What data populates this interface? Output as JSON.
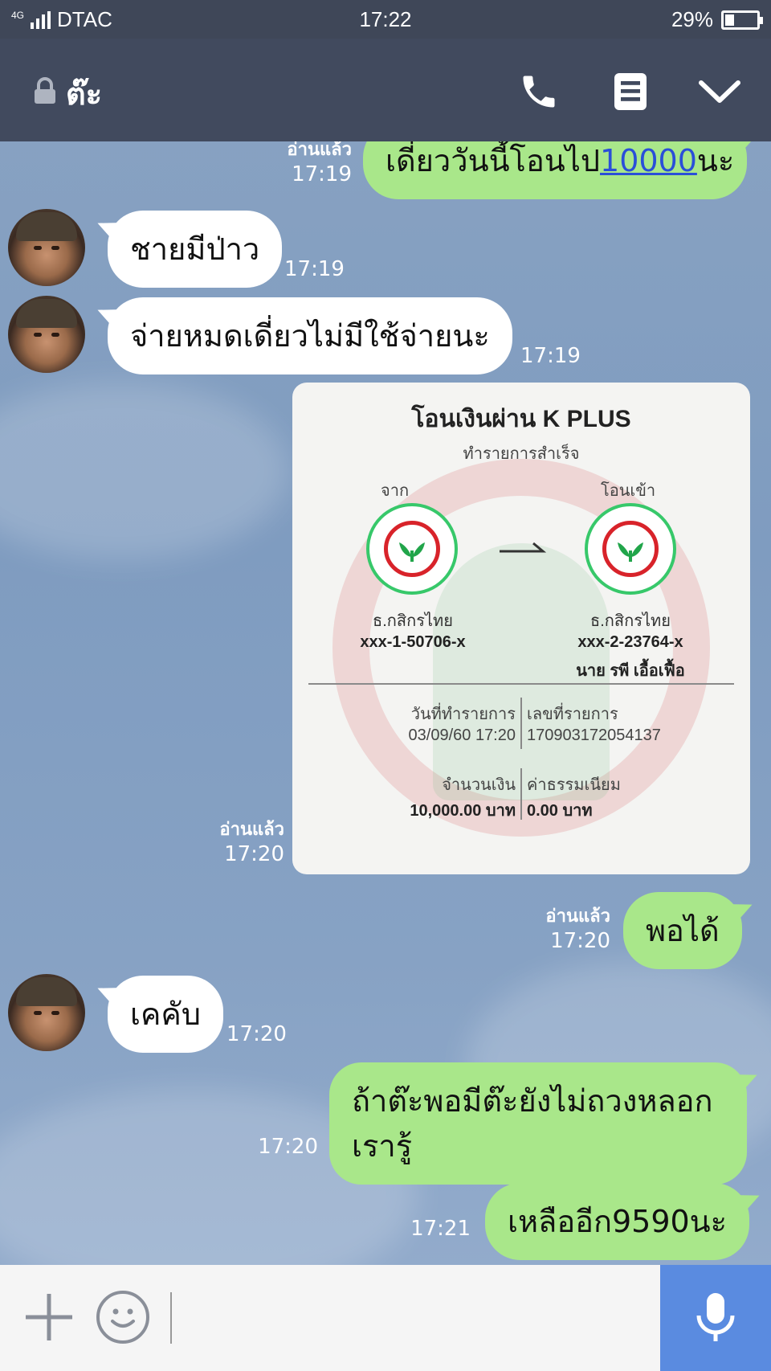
{
  "status_bar": {
    "network": "4G",
    "carrier": "DTAC",
    "time": "17:22",
    "battery_percent_label": "29%",
    "battery_level": 0.29
  },
  "header": {
    "title": "ต๊ะ",
    "icons": [
      "lock-icon",
      "phone-icon",
      "notes-icon",
      "chevron-down-icon"
    ]
  },
  "messages": [
    {
      "side": "out",
      "text_before": "เดี่ยววันนี้โอนไป",
      "link": "10000",
      "text_after": "นะ",
      "read": "อ่านแล้ว",
      "time": "17:19"
    },
    {
      "side": "in",
      "text": "ชายมีป่าว",
      "time": "17:19"
    },
    {
      "side": "in",
      "text": "จ่ายหมดเดี่ยวไม่มีใช้จ่ายนะ",
      "time": "17:19"
    },
    {
      "side": "out",
      "type": "image",
      "read": "อ่านแล้ว",
      "time": "17:20"
    },
    {
      "side": "out",
      "text": "พอได้",
      "read": "อ่านแล้ว",
      "time": "17:20"
    },
    {
      "side": "in",
      "text": "เคคับ",
      "time": "17:20"
    },
    {
      "side": "out",
      "text_line1": "ถ้าต๊ะพอมีต๊ะยังไม่ถวงหลอก",
      "text_line2": "เรารู้",
      "time": "17:20"
    },
    {
      "side": "out",
      "text": "เหลืออีก9590นะ",
      "time": "17:21"
    }
  ],
  "receipt": {
    "title": "โอนเงินผ่าน K PLUS",
    "subtitle": "ทำรายการสำเร็จ",
    "from_label": "จาก",
    "to_label": "โอนเข้า",
    "from_bank": "ธ.กสิกรไทย",
    "from_account": "xxx-1-50706-x",
    "to_bank": "ธ.กสิกรไทย",
    "to_account": "xxx-2-23764-x",
    "to_name": "นาย รพี เอื้อเฟื้อ",
    "date_label": "วันที่ทำรายการ",
    "date_value": "03/09/60 17:20",
    "ref_label": "เลขที่รายการ",
    "ref_value": "170903172054137",
    "amount_label": "จำนวนเงิน",
    "amount_value": "10,000.00 บาท",
    "fee_label": "ค่าธรรมเนียม",
    "fee_value": "0.00 บาท"
  },
  "input_bar": {
    "icons": [
      "plus-icon",
      "emoji-icon",
      "microphone-icon"
    ]
  },
  "colors": {
    "header_bg": "#414a5e",
    "outgoing_bubble": "#a9e78a",
    "incoming_bubble": "#ffffff",
    "mic_button": "#5a8be0",
    "link": "#2a4fd8"
  }
}
